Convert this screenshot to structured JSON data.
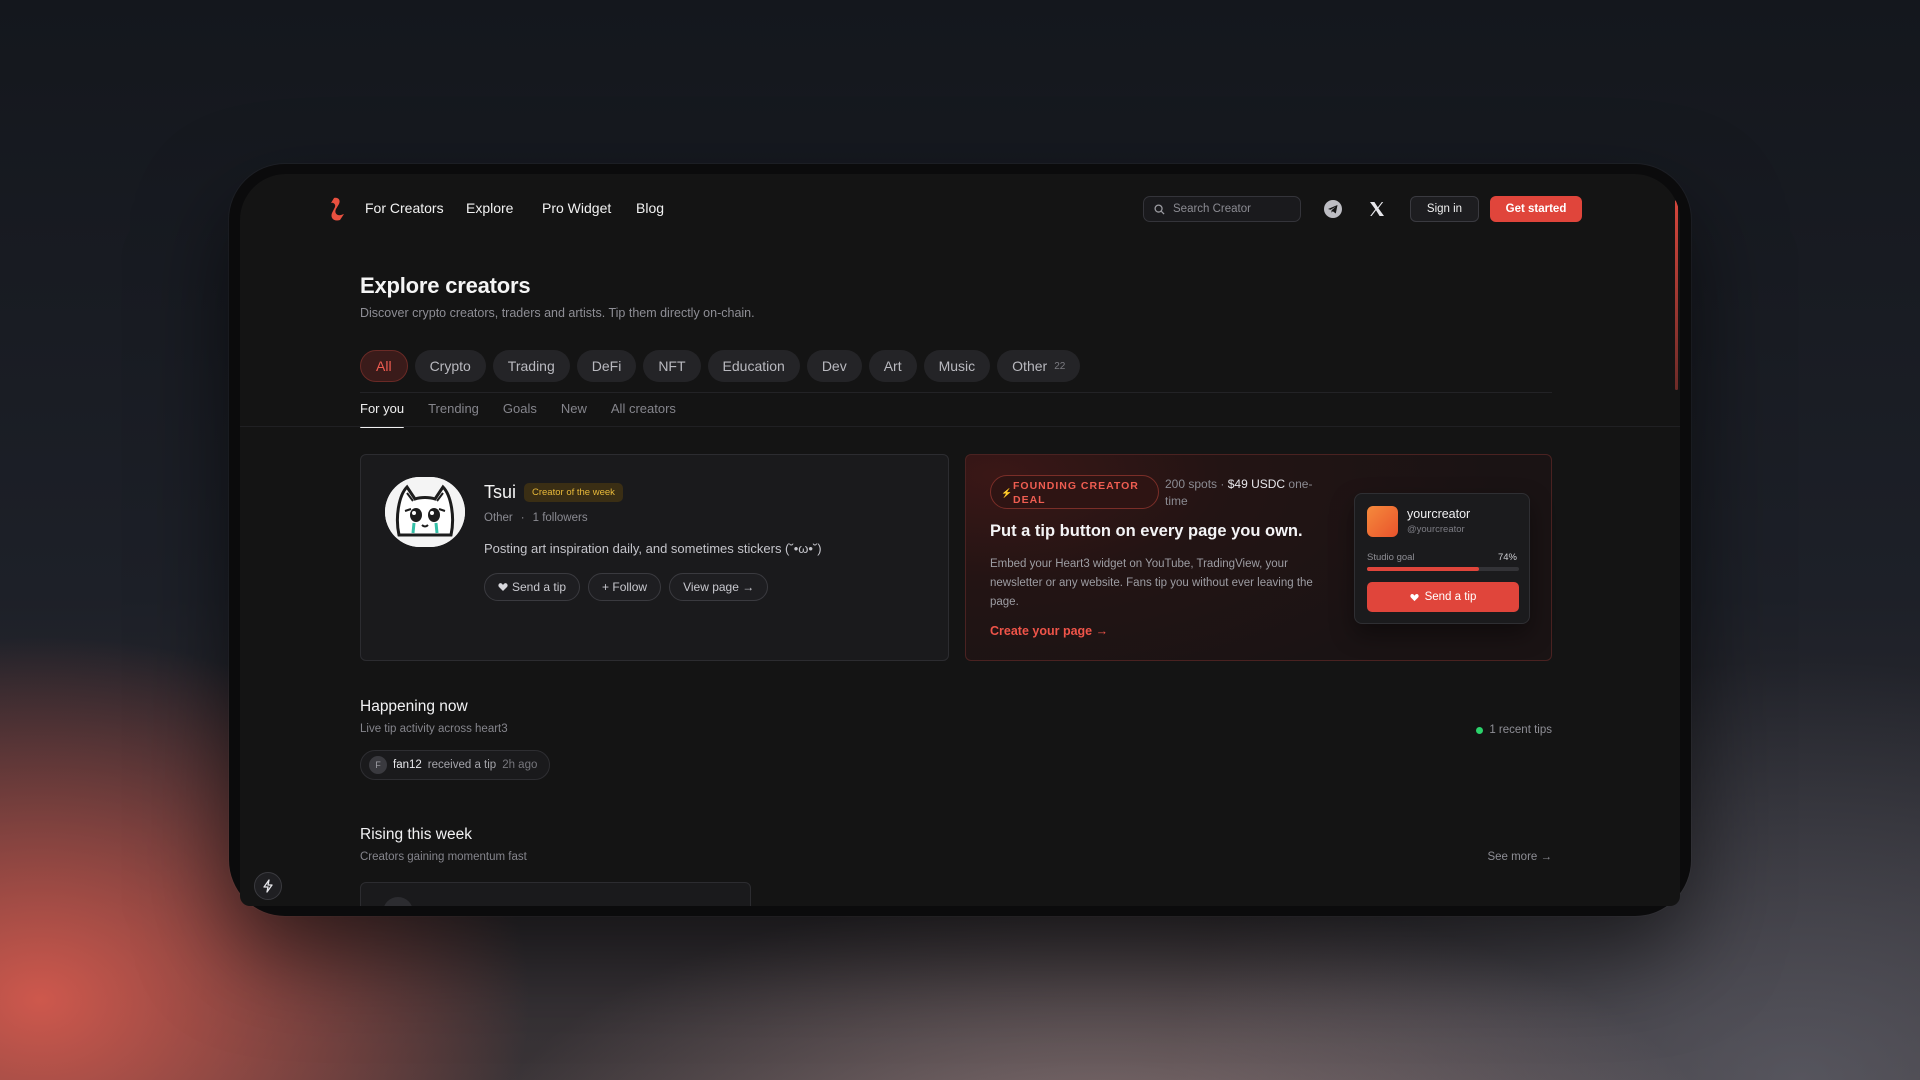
{
  "nav": {
    "links": [
      "For Creators",
      "Explore",
      "Pro Widget",
      "Blog"
    ],
    "search_placeholder": "Search Creator",
    "sign_in": "Sign in",
    "get_started": "Get started"
  },
  "page": {
    "title": "Explore creators",
    "subtitle": "Discover crypto creators, traders and artists. Tip them directly on-chain."
  },
  "categories": [
    {
      "label": "All",
      "active": true
    },
    {
      "label": "Crypto"
    },
    {
      "label": "Trading"
    },
    {
      "label": "DeFi"
    },
    {
      "label": "NFT"
    },
    {
      "label": "Education"
    },
    {
      "label": "Dev"
    },
    {
      "label": "Art"
    },
    {
      "label": "Music"
    },
    {
      "label": "Other",
      "count": "22"
    }
  ],
  "tabs": [
    "For you",
    "Trending",
    "Goals",
    "New",
    "All creators"
  ],
  "featured": {
    "name": "Tsui",
    "badge": "Creator of the week",
    "category": "Other",
    "followers": "1 followers",
    "bio": "Posting art inspiration daily, and sometimes stickers (˘•ω•˘)",
    "send_tip": "Send a tip",
    "follow": "+ Follow",
    "view_page": "View page →"
  },
  "promo": {
    "badge": "FOUNDING CREATOR DEAL",
    "spots": "200 spots ·",
    "price": "$49 USDC",
    "term": "one-time",
    "title": "Put a tip button on every page you own.",
    "description": "Embed your Heart3 widget on YouTube, TradingView, your newsletter or any website. Fans tip you without ever leaving the page.",
    "cta": "Create your page →",
    "widget": {
      "name": "yourcreator",
      "handle": "@yourcreator",
      "goal_label": "Studio goal",
      "goal_percent_text": "74%",
      "goal_fraction": 0.74,
      "button": "Send a tip"
    }
  },
  "happening": {
    "title": "Happening now",
    "subtitle": "Live tip activity across heart3",
    "live_count": "1 recent tips",
    "activity": {
      "initial": "F",
      "user": "fan12",
      "action": "received a tip",
      "time": "2h ago"
    }
  },
  "rising": {
    "title": "Rising this week",
    "subtitle": "Creators gaining momentum fast",
    "see_more": "See more →"
  },
  "colors": {
    "accent": "#e0453b",
    "badge_gold": "#e8b93a",
    "live": "#2bd26b"
  },
  "icons": [
    "logo-icon",
    "search-icon",
    "telegram-icon",
    "x-icon",
    "heart-icon",
    "bolt-icon"
  ]
}
